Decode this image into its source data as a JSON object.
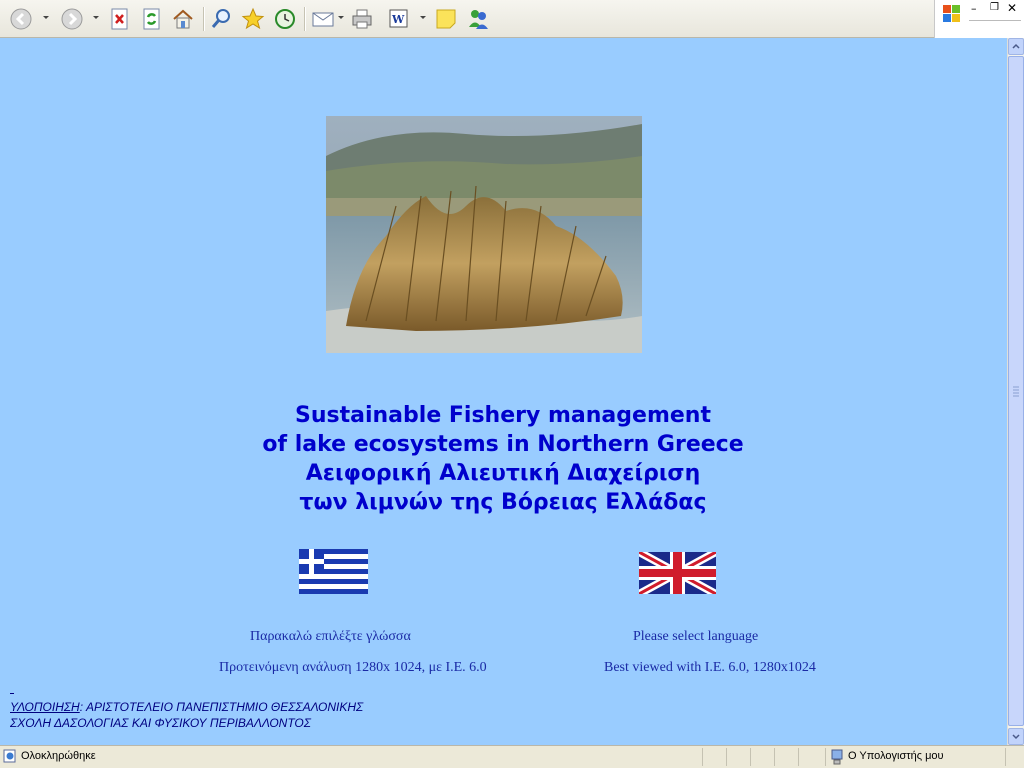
{
  "toolbar": {
    "icons": [
      "back-icon",
      "forward-icon",
      "stop-icon",
      "refresh-icon",
      "home-icon",
      "search-icon",
      "favorites-icon",
      "history-icon",
      "mail-icon",
      "print-icon",
      "edit-icon",
      "discuss-icon",
      "messenger-icon"
    ]
  },
  "hero": {
    "title_lines": [
      "Sustainable Fishery management",
      "of lake ecosystems in Northern Greece",
      "Αειφορική Αλιευτική Διαχείριση",
      "των λιμνών της Βόρειας Ελλάδας"
    ]
  },
  "language": {
    "greek_prompt": "Παρακαλώ επιλέξτε γλώσσα",
    "english_prompt": "Please select language",
    "greek_note": "Προτεινόμενη ανάλυση 1280x 1024, με I.E. 6.0",
    "english_note": "Best viewed with I.E. 6.0, 1280x1024"
  },
  "footer": {
    "credit_label": "ΥΛΟΠΟΙΗΣΗ",
    "credit_org": ": ΑΡΙΣΤΟΤΕΛΕΙΟ ΠΑΝΕΠΙΣΤΗΜΙΟ ΘΕΣΣΑΛΟΝΙΚΗΣ",
    "credit_school": "ΣΧΟΛΗ ΔΑΣΟΛΟΓΙΑΣ ΚΑΙ ΦΥΣΙΚΟΥ ΠΕΡΙΒΑΛΛΟΝΤΟΣ"
  },
  "statusbar": {
    "status_text": "Ολοκληρώθηκε",
    "zone_text": "Ο Υπολογιστής μου"
  },
  "colors": {
    "page_background": "#99ccff",
    "title_color": "#0000cc",
    "text_color": "#1a2aa5"
  }
}
